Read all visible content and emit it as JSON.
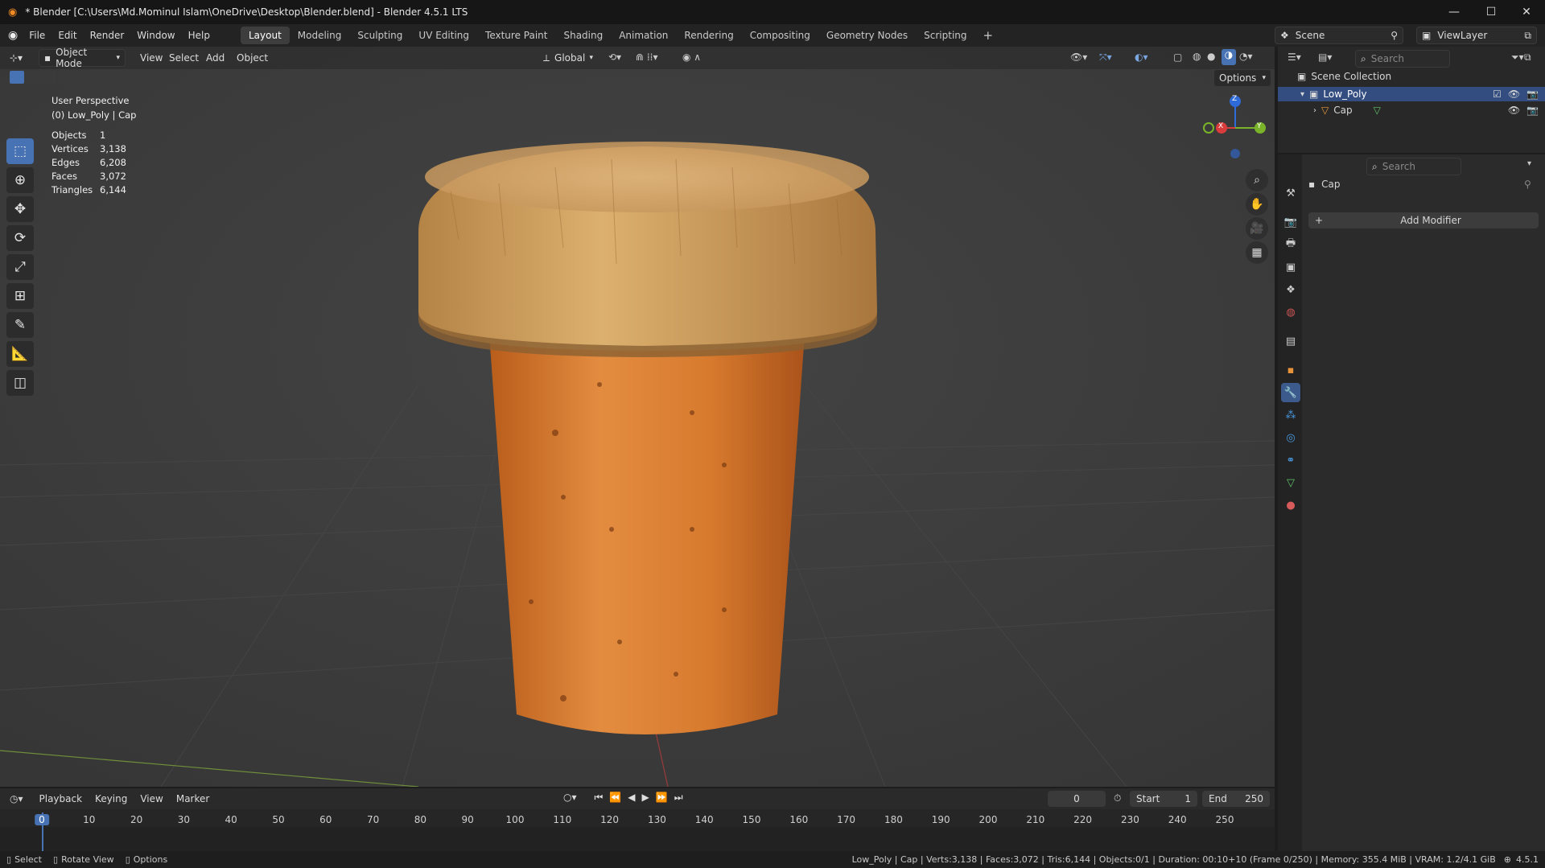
{
  "window": {
    "title": "* Blender [C:\\Users\\Md.Mominul Islam\\OneDrive\\Desktop\\Blender.blend] - Blender 4.5.1 LTS",
    "minimize": "—",
    "maximize": "☐",
    "close": "✕"
  },
  "menubar": {
    "items": [
      "File",
      "Edit",
      "Render",
      "Window",
      "Help"
    ],
    "workspaces": [
      "Layout",
      "Modeling",
      "Sculpting",
      "UV Editing",
      "Texture Paint",
      "Shading",
      "Animation",
      "Rendering",
      "Compositing",
      "Geometry Nodes",
      "Scripting"
    ],
    "active_workspace": "Layout",
    "add_tab": "+",
    "scene_label": "Scene",
    "viewlayer_label": "ViewLayer"
  },
  "viewport_header": {
    "mode": "Object Mode",
    "menus": [
      "View",
      "Select",
      "Add",
      "Object"
    ],
    "orientation": "Global",
    "options": "Options"
  },
  "overlay_text": {
    "perspective": "User Perspective",
    "collection_object": "(0) Low_Poly | Cap"
  },
  "stats": [
    {
      "label": "Objects",
      "value": "1"
    },
    {
      "label": "Vertices",
      "value": "3,138"
    },
    {
      "label": "Edges",
      "value": "6,208"
    },
    {
      "label": "Faces",
      "value": "3,072"
    },
    {
      "label": "Triangles",
      "value": "6,144"
    }
  ],
  "gizmo": {
    "z": "Z",
    "x": "X",
    "y": "Y"
  },
  "outliner": {
    "search_placeholder": "Search",
    "root": "Scene Collection",
    "collection": "Low_Poly",
    "object": "Cap"
  },
  "properties": {
    "search_placeholder": "Search",
    "object_name": "Cap",
    "add_modifier": "Add Modifier"
  },
  "timeline": {
    "menus": [
      "Playback",
      "Keying",
      "View",
      "Marker"
    ],
    "current_frame": "0",
    "start_label": "Start",
    "start_value": "1",
    "end_label": "End",
    "end_value": "250",
    "ticks": [
      "0",
      "10",
      "20",
      "30",
      "40",
      "50",
      "60",
      "70",
      "80",
      "90",
      "100",
      "110",
      "120",
      "130",
      "140",
      "150",
      "160",
      "170",
      "180",
      "190",
      "200",
      "210",
      "220",
      "230",
      "240",
      "250"
    ]
  },
  "statusbar": {
    "select": "Select",
    "rotate": "Rotate View",
    "options": "Options",
    "info": "Low_Poly | Cap | Verts:3,138 | Faces:3,072 | Tris:6,144 | Objects:0/1 | Duration: 00:10+10 (Frame 0/250) | Memory: 355.4 MiB | VRAM: 1.2/4.1 GiB",
    "version": "4.5.1"
  },
  "colors": {
    "accent": "#4772b3",
    "cork_dark": "#c8661f",
    "cork_light": "#e08a3c",
    "wood": "#c9995a"
  }
}
